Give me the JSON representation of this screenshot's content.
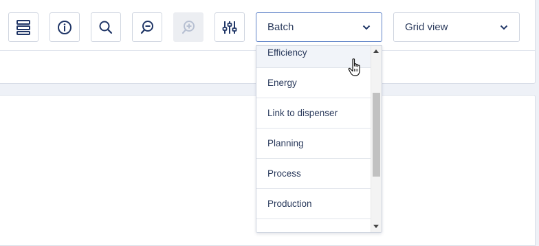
{
  "toolbar": {
    "buttons": [
      {
        "name": "layout-rows-button",
        "icon": "rows-icon"
      },
      {
        "name": "info-button",
        "icon": "info-icon"
      },
      {
        "name": "search-button",
        "icon": "search-icon"
      },
      {
        "name": "zoom-out-button",
        "icon": "zoom-out-icon"
      },
      {
        "name": "zoom-in-button",
        "icon": "zoom-in-icon",
        "disabled": true
      },
      {
        "name": "filter-settings-button",
        "icon": "sliders-icon"
      }
    ],
    "category_select": {
      "value": "Batch",
      "open": true
    },
    "view_select": {
      "value": "Grid view"
    }
  },
  "dropdown": {
    "items": [
      {
        "label": "Efficiency",
        "hovered": true
      },
      {
        "label": "Energy"
      },
      {
        "label": "Link to dispenser"
      },
      {
        "label": "Planning"
      },
      {
        "label": "Process"
      },
      {
        "label": "Production"
      },
      {
        "label": ""
      }
    ],
    "scroll_fraction": 0.45,
    "thumb_fraction": 0.5
  },
  "colors": {
    "icon": "#1f3566",
    "icon_disabled": "#b7c0d2",
    "accent_border": "#5b7fc6",
    "background": "#eef1f7",
    "panel": "#ffffff"
  },
  "icons": {
    "pointer": "hand-pointer-cursor-icon"
  }
}
